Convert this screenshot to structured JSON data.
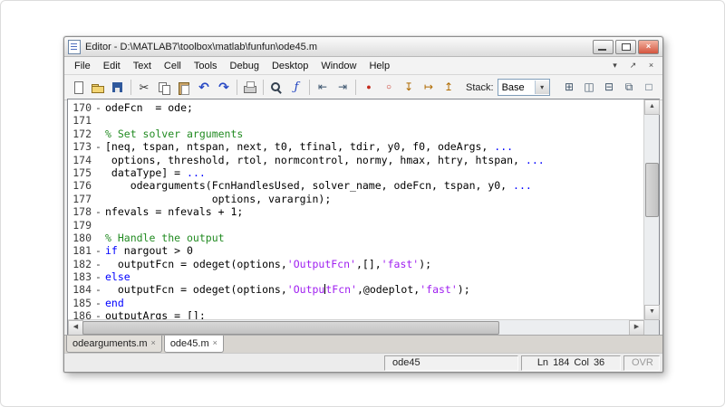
{
  "window": {
    "title": "Editor - D:\\MATLAB7\\toolbox\\matlab\\funfun\\ode45.m"
  },
  "menu": {
    "items": [
      "File",
      "Edit",
      "Text",
      "Cell",
      "Tools",
      "Debug",
      "Desktop",
      "Window",
      "Help"
    ],
    "right_icons": [
      {
        "name": "show-actions-icon",
        "glyph": "▾"
      },
      {
        "name": "undock-icon",
        "glyph": "↗"
      },
      {
        "name": "close-document-icon",
        "glyph": "×"
      }
    ]
  },
  "toolbar": {
    "stack_label": "Stack:",
    "stack_value": "Base",
    "icons_left": [
      {
        "name": "new-file-icon",
        "kind": "new"
      },
      {
        "name": "open-file-icon",
        "kind": "open"
      },
      {
        "name": "save-icon",
        "kind": "save"
      },
      {
        "kind": "sep"
      },
      {
        "name": "cut-icon",
        "kind": "cut",
        "glyph": "✂"
      },
      {
        "name": "copy-icon",
        "kind": "copy"
      },
      {
        "name": "paste-icon",
        "kind": "paste"
      },
      {
        "name": "undo-icon",
        "kind": "undo",
        "glyph": "↶"
      },
      {
        "name": "redo-icon",
        "kind": "redo",
        "glyph": "↷"
      },
      {
        "kind": "sep"
      },
      {
        "name": "print-icon",
        "kind": "print"
      },
      {
        "kind": "sep"
      },
      {
        "name": "find-icon",
        "kind": "find"
      },
      {
        "name": "insert-function-icon",
        "kind": "function",
        "glyph": "ƒ"
      },
      {
        "kind": "sep"
      },
      {
        "name": "go-back-icon",
        "kind": "back",
        "glyph": "⇤"
      },
      {
        "name": "go-forward-icon",
        "kind": "forward",
        "glyph": "⇥"
      },
      {
        "kind": "sep"
      },
      {
        "name": "set-breakpoint-icon",
        "kind": "bp-set",
        "glyph": "●"
      },
      {
        "name": "clear-breakpoints-icon",
        "kind": "bp-clear",
        "glyph": "○"
      },
      {
        "name": "step-icon",
        "kind": "step",
        "glyph": "↧"
      },
      {
        "name": "step-in-icon",
        "kind": "step-in",
        "glyph": "↦"
      },
      {
        "name": "step-out-icon",
        "kind": "step-out",
        "glyph": "↥"
      }
    ],
    "icons_right": [
      {
        "name": "tile-windows-icon",
        "kind": "tile",
        "glyph": "⊞"
      },
      {
        "name": "split-left-right-icon",
        "kind": "split-lr",
        "glyph": "◫"
      },
      {
        "name": "split-top-bottom-icon",
        "kind": "split-tb",
        "glyph": "⊟"
      },
      {
        "name": "float-window-icon",
        "kind": "float",
        "glyph": "⧉"
      },
      {
        "name": "maximize-document-icon",
        "kind": "max",
        "glyph": "□"
      }
    ]
  },
  "editor": {
    "lines": [
      {
        "num": "170",
        "exec": true,
        "segs": [
          [
            "p",
            "odeFcn  = ode;"
          ]
        ]
      },
      {
        "num": "171",
        "exec": false,
        "segs": []
      },
      {
        "num": "172",
        "exec": false,
        "segs": [
          [
            "c",
            "% Set solver arguments"
          ]
        ]
      },
      {
        "num": "173",
        "exec": true,
        "segs": [
          [
            "p",
            "[neq, tspan, ntspan, next, t0, tfinal, tdir, y0, f0, odeArgs, "
          ],
          [
            "k",
            "..."
          ]
        ]
      },
      {
        "num": "174",
        "exec": false,
        "segs": [
          [
            "p",
            " options, threshold, rtol, normcontrol, normy, hmax, htry, htspan, "
          ],
          [
            "k",
            "..."
          ]
        ]
      },
      {
        "num": "175",
        "exec": false,
        "segs": [
          [
            "p",
            " dataType] = "
          ],
          [
            "k",
            "..."
          ]
        ]
      },
      {
        "num": "176",
        "exec": false,
        "segs": [
          [
            "p",
            "    odearguments(FcnHandlesUsed, solver_name, odeFcn, tspan, y0, "
          ],
          [
            "k",
            "..."
          ]
        ]
      },
      {
        "num": "177",
        "exec": false,
        "segs": [
          [
            "p",
            "                 options, varargin);"
          ]
        ]
      },
      {
        "num": "178",
        "exec": true,
        "segs": [
          [
            "p",
            "nfevals = nfevals + 1;"
          ]
        ]
      },
      {
        "num": "179",
        "exec": false,
        "segs": []
      },
      {
        "num": "180",
        "exec": false,
        "segs": [
          [
            "c",
            "% Handle the output"
          ]
        ]
      },
      {
        "num": "181",
        "exec": true,
        "segs": [
          [
            "k",
            "if"
          ],
          [
            "p",
            " nargout > 0"
          ]
        ]
      },
      {
        "num": "182",
        "exec": true,
        "segs": [
          [
            "p",
            "  outputFcn = odeget(options,"
          ],
          [
            "s",
            "'OutputFcn'"
          ],
          [
            "p",
            ",[],"
          ],
          [
            "s",
            "'fast'"
          ],
          [
            "p",
            ");"
          ]
        ]
      },
      {
        "num": "183",
        "exec": true,
        "segs": [
          [
            "k",
            "else"
          ]
        ]
      },
      {
        "num": "184",
        "exec": true,
        "segs": [
          [
            "p",
            "  outputFcn = odeget(options,"
          ],
          [
            "s",
            "'Outpu"
          ],
          [
            "caret",
            ""
          ],
          [
            "s",
            "tFcn'"
          ],
          [
            "p",
            ",@odeplot,"
          ],
          [
            "s",
            "'fast'"
          ],
          [
            "p",
            ");"
          ]
        ]
      },
      {
        "num": "185",
        "exec": true,
        "segs": [
          [
            "k",
            "end"
          ]
        ]
      },
      {
        "num": "186",
        "exec": true,
        "segs": [
          [
            "p",
            "outputArgs = [];"
          ]
        ]
      }
    ]
  },
  "tabs": [
    {
      "label": "odearguments.m",
      "close": "×",
      "active": false
    },
    {
      "label": "ode45.m",
      "close": "×",
      "active": true
    }
  ],
  "status": {
    "function_name": "ode45",
    "line_label": "Ln",
    "line": "184",
    "col_label": "Col",
    "col": "36",
    "mode": "OVR"
  },
  "colors": {
    "comment": "#228b22",
    "keyword": "#0000ff",
    "string": "#a020f0",
    "plain": "#000000"
  }
}
